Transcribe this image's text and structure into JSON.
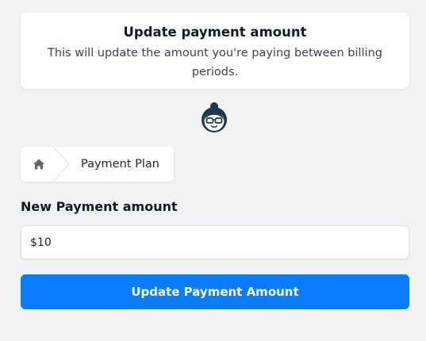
{
  "info": {
    "title": "Update payment amount",
    "description": "This will update the amount you're paying between billing periods."
  },
  "avatar": {
    "icon": "assistant-avatar-icon"
  },
  "breadcrumb": {
    "home_icon": "home-icon",
    "current": "Payment Plan"
  },
  "form": {
    "label": "New Payment amount",
    "amount_value": "$10",
    "submit_label": "Update Payment Amount"
  },
  "colors": {
    "background": "#f1f2f4",
    "accent": "#0a7cff",
    "card": "#ffffff",
    "icon_dark": "#1f3550"
  }
}
